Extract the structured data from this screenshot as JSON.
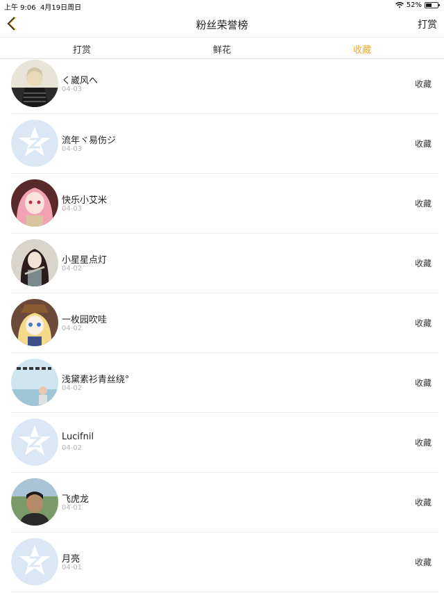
{
  "status": {
    "time": "上午 9:06",
    "date": "4月19日周日",
    "battery": "52%",
    "battery_level": 0.52
  },
  "nav": {
    "title": "粉丝荣誉榜",
    "right": "打赏"
  },
  "tabs": [
    {
      "label": "打赏",
      "active": false
    },
    {
      "label": "鲜花",
      "active": false
    },
    {
      "label": "收藏",
      "active": true
    }
  ],
  "colors": {
    "accent": "#f5a623",
    "default_avatar": "#dbe7f5"
  },
  "rows": [
    {
      "name": "く崴风へ",
      "date": "04-03",
      "action": "收藏",
      "avatar": "photo-dark-figure"
    },
    {
      "name": "流年ヾ易伤ジ",
      "date": "04-03",
      "action": "收藏",
      "avatar": "default-qq-avatar"
    },
    {
      "name": "快乐小艾米",
      "date": "04-03",
      "action": "收藏",
      "avatar": "photo-pink-anime"
    },
    {
      "name": "小星星点灯",
      "date": "04-02",
      "action": "收藏",
      "avatar": "photo-dark-anime"
    },
    {
      "name": "一枚园吹哇",
      "date": "04-02",
      "action": "收藏",
      "avatar": "photo-blonde-anime"
    },
    {
      "name": "浅黛素衫青丝绕°",
      "date": "04-02",
      "action": "收藏",
      "avatar": "photo-sky-text"
    },
    {
      "name": "Lucifnil",
      "date": "04-02",
      "action": "收藏",
      "avatar": "default-qq-avatar"
    },
    {
      "name": "飞虎龙",
      "date": "04-01",
      "action": "收藏",
      "avatar": "photo-man"
    },
    {
      "name": "月亮",
      "date": "04-01",
      "action": "收藏",
      "avatar": "default-qq-avatar"
    }
  ]
}
